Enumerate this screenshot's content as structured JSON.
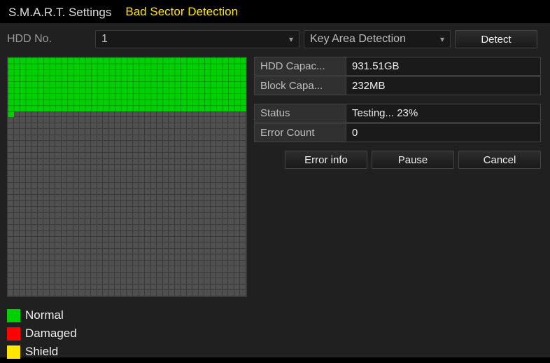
{
  "tabs": {
    "smart": "S.M.A.R.T. Settings",
    "badsector": "Bad Sector Detection"
  },
  "controls": {
    "hdd_no_label": "HDD No.",
    "hdd_no_value": "1",
    "detection_mode": "Key Area Detection",
    "detect_btn": "Detect"
  },
  "info": {
    "hdd_capacity_label": "HDD Capac...",
    "hdd_capacity_value": "931.51GB",
    "block_capacity_label": "Block Capa...",
    "block_capacity_value": "232MB",
    "status_label": "Status",
    "status_value": "Testing... 23%",
    "error_count_label": "Error Count",
    "error_count_value": "0"
  },
  "actions": {
    "error_info": "Error info",
    "pause": "Pause",
    "cancel": "Cancel"
  },
  "legend": {
    "normal": {
      "label": "Normal",
      "color": "#00d000"
    },
    "damaged": {
      "label": "Damaged",
      "color": "#ff0000"
    },
    "shield": {
      "label": "Shield",
      "color": "#ffe600"
    }
  },
  "sector_map": {
    "cols": 40,
    "rows": 40,
    "progress_percent": 23
  }
}
